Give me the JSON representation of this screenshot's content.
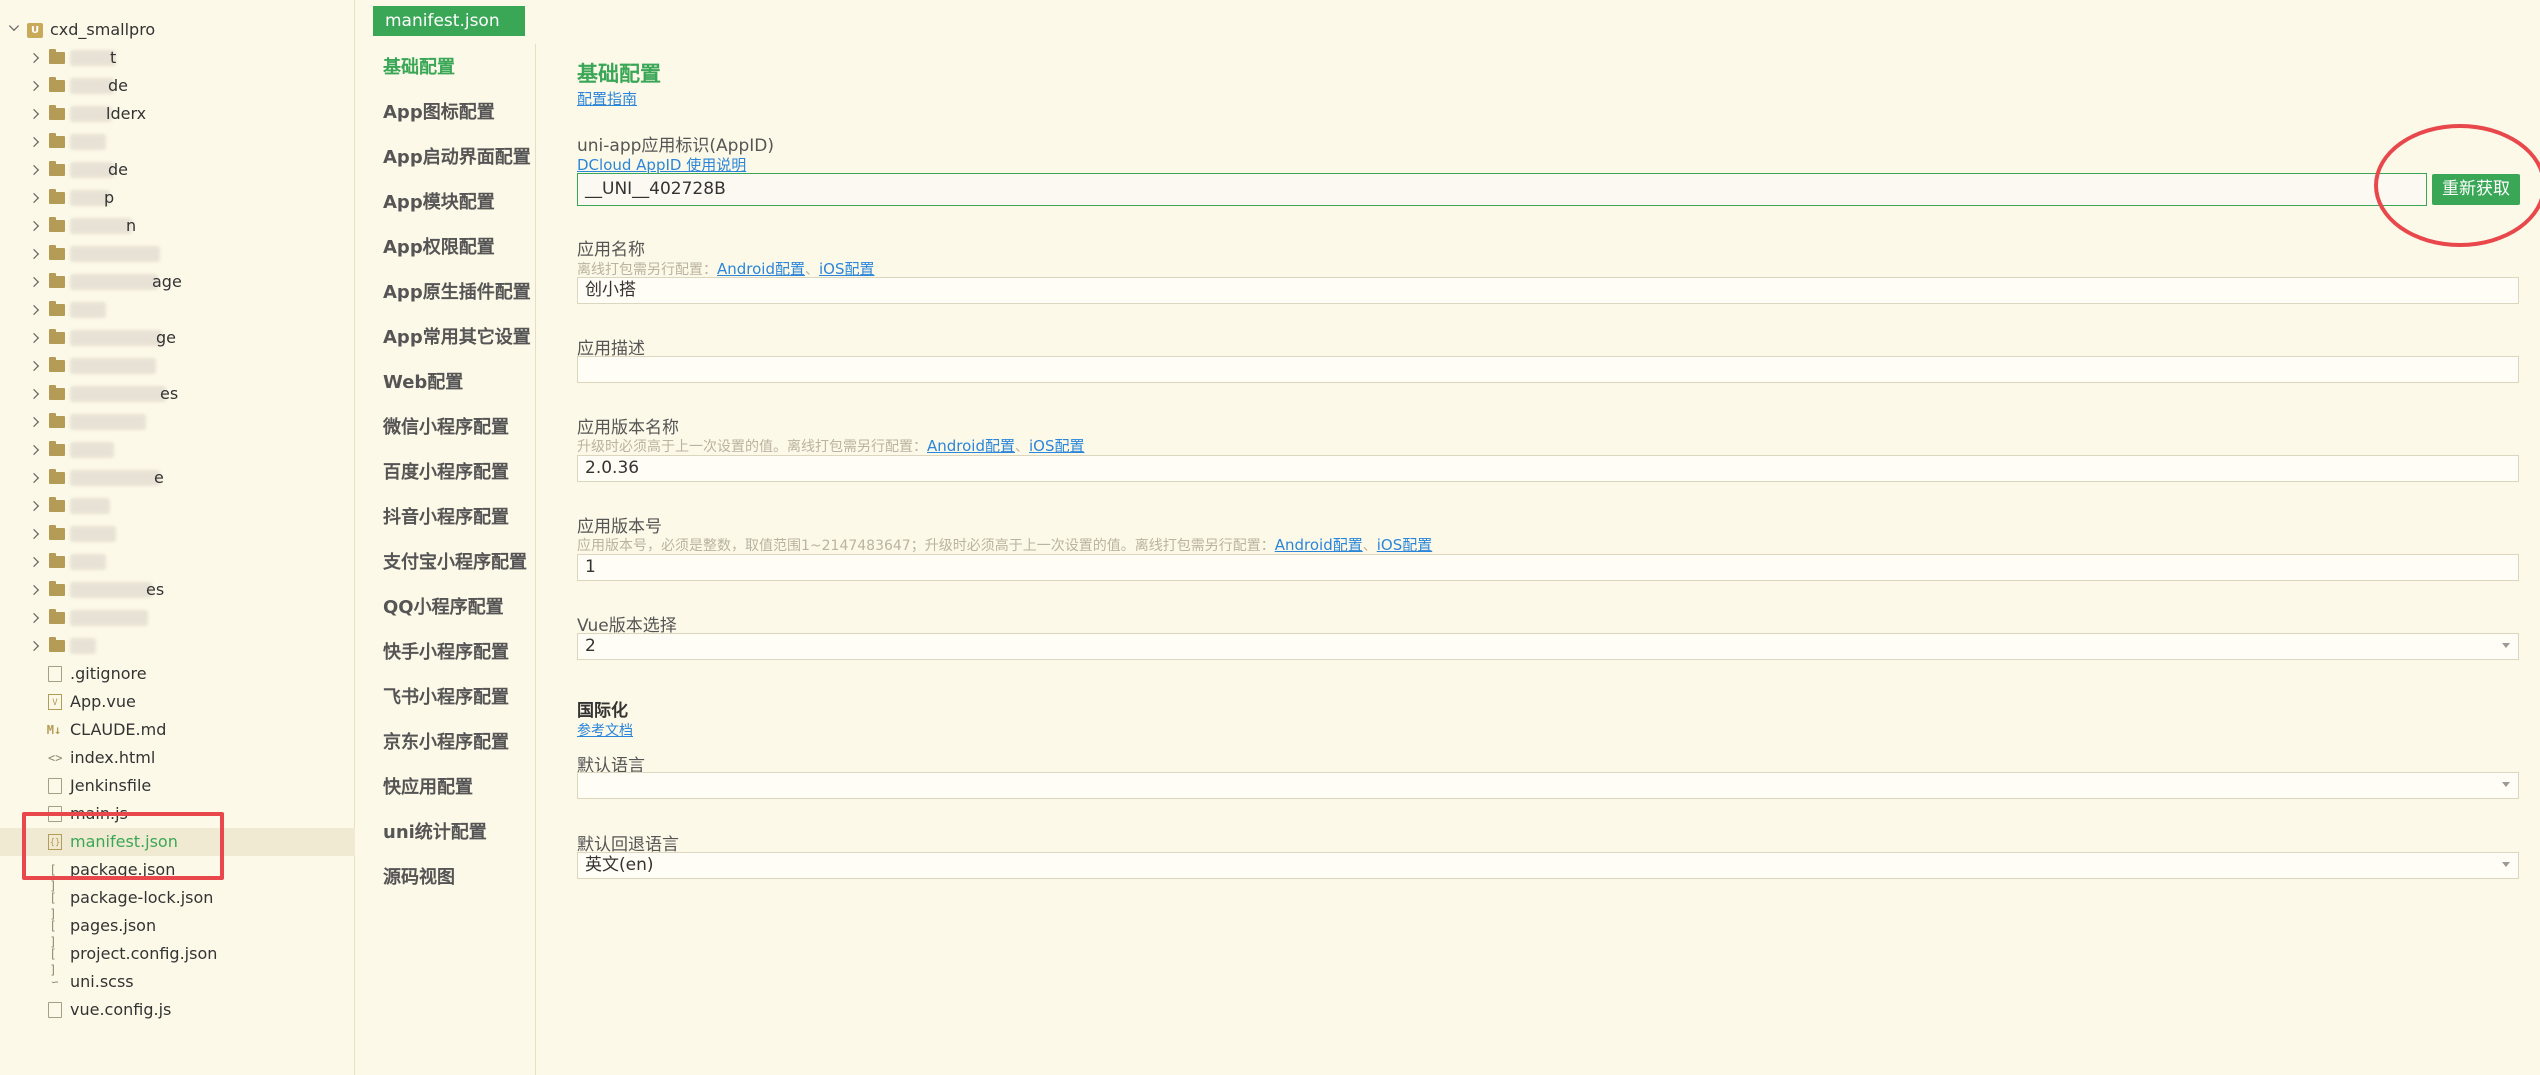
{
  "tree": {
    "root": "cxd_smallpro",
    "root_icon": "U",
    "folders": [
      {
        "tail": "t",
        "blob": 46
      },
      {
        "tail": "de",
        "blob": 44
      },
      {
        "tail": "lderx",
        "blob": 42
      },
      {
        "tail": "",
        "blob": 36
      },
      {
        "tail": "de",
        "blob": 44
      },
      {
        "tail": "p",
        "blob": 40
      },
      {
        "tail": "n",
        "blob": 62
      },
      {
        "tail": "",
        "blob": 90
      },
      {
        "tail": "age",
        "blob": 88
      },
      {
        "tail": "",
        "blob": 36
      },
      {
        "tail": "ge",
        "blob": 92
      },
      {
        "tail": "",
        "blob": 86
      },
      {
        "tail": "es",
        "blob": 96
      },
      {
        "tail": "",
        "blob": 76
      },
      {
        "tail": "",
        "blob": 44
      },
      {
        "tail": "e",
        "blob": 90
      },
      {
        "tail": "",
        "blob": 40
      },
      {
        "tail": "",
        "blob": 46
      },
      {
        "tail": "",
        "blob": 36
      },
      {
        "tail": "es",
        "blob": 82
      },
      {
        "tail": "",
        "blob": 78
      },
      {
        "tail": "",
        "blob": 26
      }
    ],
    "files": [
      {
        "name": ".gitignore",
        "icon": "file-icon",
        "glyph": ""
      },
      {
        "name": "App.vue",
        "icon": "vue-file-icon",
        "glyph": "V"
      },
      {
        "name": "CLAUDE.md",
        "icon": "markdown-icon",
        "glyph": "M↓"
      },
      {
        "name": "index.html",
        "icon": "html-icon",
        "glyph": "<>"
      },
      {
        "name": "Jenkinsfile",
        "icon": "file-icon",
        "glyph": ""
      },
      {
        "name": "main.js",
        "icon": "js-file-icon",
        "glyph": ""
      },
      {
        "name": "manifest.json",
        "icon": "json-file-icon",
        "glyph": "{}"
      },
      {
        "name": "package.json",
        "icon": "json-bracket-icon",
        "glyph": "[ ]"
      },
      {
        "name": "package-lock.json",
        "icon": "json-bracket-icon",
        "glyph": "[ ]"
      },
      {
        "name": "pages.json",
        "icon": "json-bracket-icon",
        "glyph": "[ ]"
      },
      {
        "name": "project.config.json",
        "icon": "json-bracket-icon",
        "glyph": "[ ]"
      },
      {
        "name": "uni.scss",
        "icon": "scss-icon",
        "glyph": "∽"
      },
      {
        "name": "vue.config.js",
        "icon": "js-file-icon",
        "glyph": ""
      }
    ],
    "active_file": "manifest.json"
  },
  "tab": {
    "label": "manifest.json"
  },
  "nav": {
    "items": [
      "基础配置",
      "App图标配置",
      "App启动界面配置",
      "App模块配置",
      "App权限配置",
      "App原生插件配置",
      "App常用其它设置",
      "Web配置",
      "微信小程序配置",
      "百度小程序配置",
      "抖音小程序配置",
      "支付宝小程序配置",
      "QQ小程序配置",
      "快手小程序配置",
      "飞书小程序配置",
      "京东小程序配置",
      "快应用配置",
      "uni统计配置",
      "源码视图"
    ],
    "active_index": 0
  },
  "content": {
    "title": "基础配置",
    "guide_link": "配置指南",
    "appid": {
      "label": "uni-app应用标识(AppID)",
      "help_link": "DCloud AppID 使用说明",
      "value": "__UNI__402728B",
      "refetch_button": "重新获取"
    },
    "app_name": {
      "label": "应用名称",
      "hint": "离线打包需另行配置：",
      "android_link": "Android配置",
      "ios_link": "iOS配置",
      "value": "创小搭"
    },
    "app_desc": {
      "label": "应用描述",
      "value": ""
    },
    "version_name": {
      "label": "应用版本名称",
      "hint": "升级时必须高于上一次设置的值。离线打包需另行配置：",
      "android_link": "Android配置",
      "ios_link": "iOS配置",
      "value": "2.0.36"
    },
    "version_code": {
      "label": "应用版本号",
      "hint": "应用版本号，必须是整数，取值范围1~2147483647；升级时必须高于上一次设置的值。离线打包需另行配置：",
      "android_link": "Android配置",
      "ios_link": "iOS配置",
      "value": "1"
    },
    "vue_version": {
      "label": "Vue版本选择",
      "value": "2"
    },
    "i18n": {
      "title": "国际化",
      "doc_link": "参考文档",
      "default_lang_label": "默认语言",
      "default_lang_value": "",
      "fallback_lang_label": "默认回退语言",
      "fallback_lang_value": "英文(en)"
    }
  },
  "colors": {
    "accent": "#3aa757",
    "link": "#2b86d9",
    "annotation": "#e8474c",
    "background": "#fdf9e8"
  }
}
